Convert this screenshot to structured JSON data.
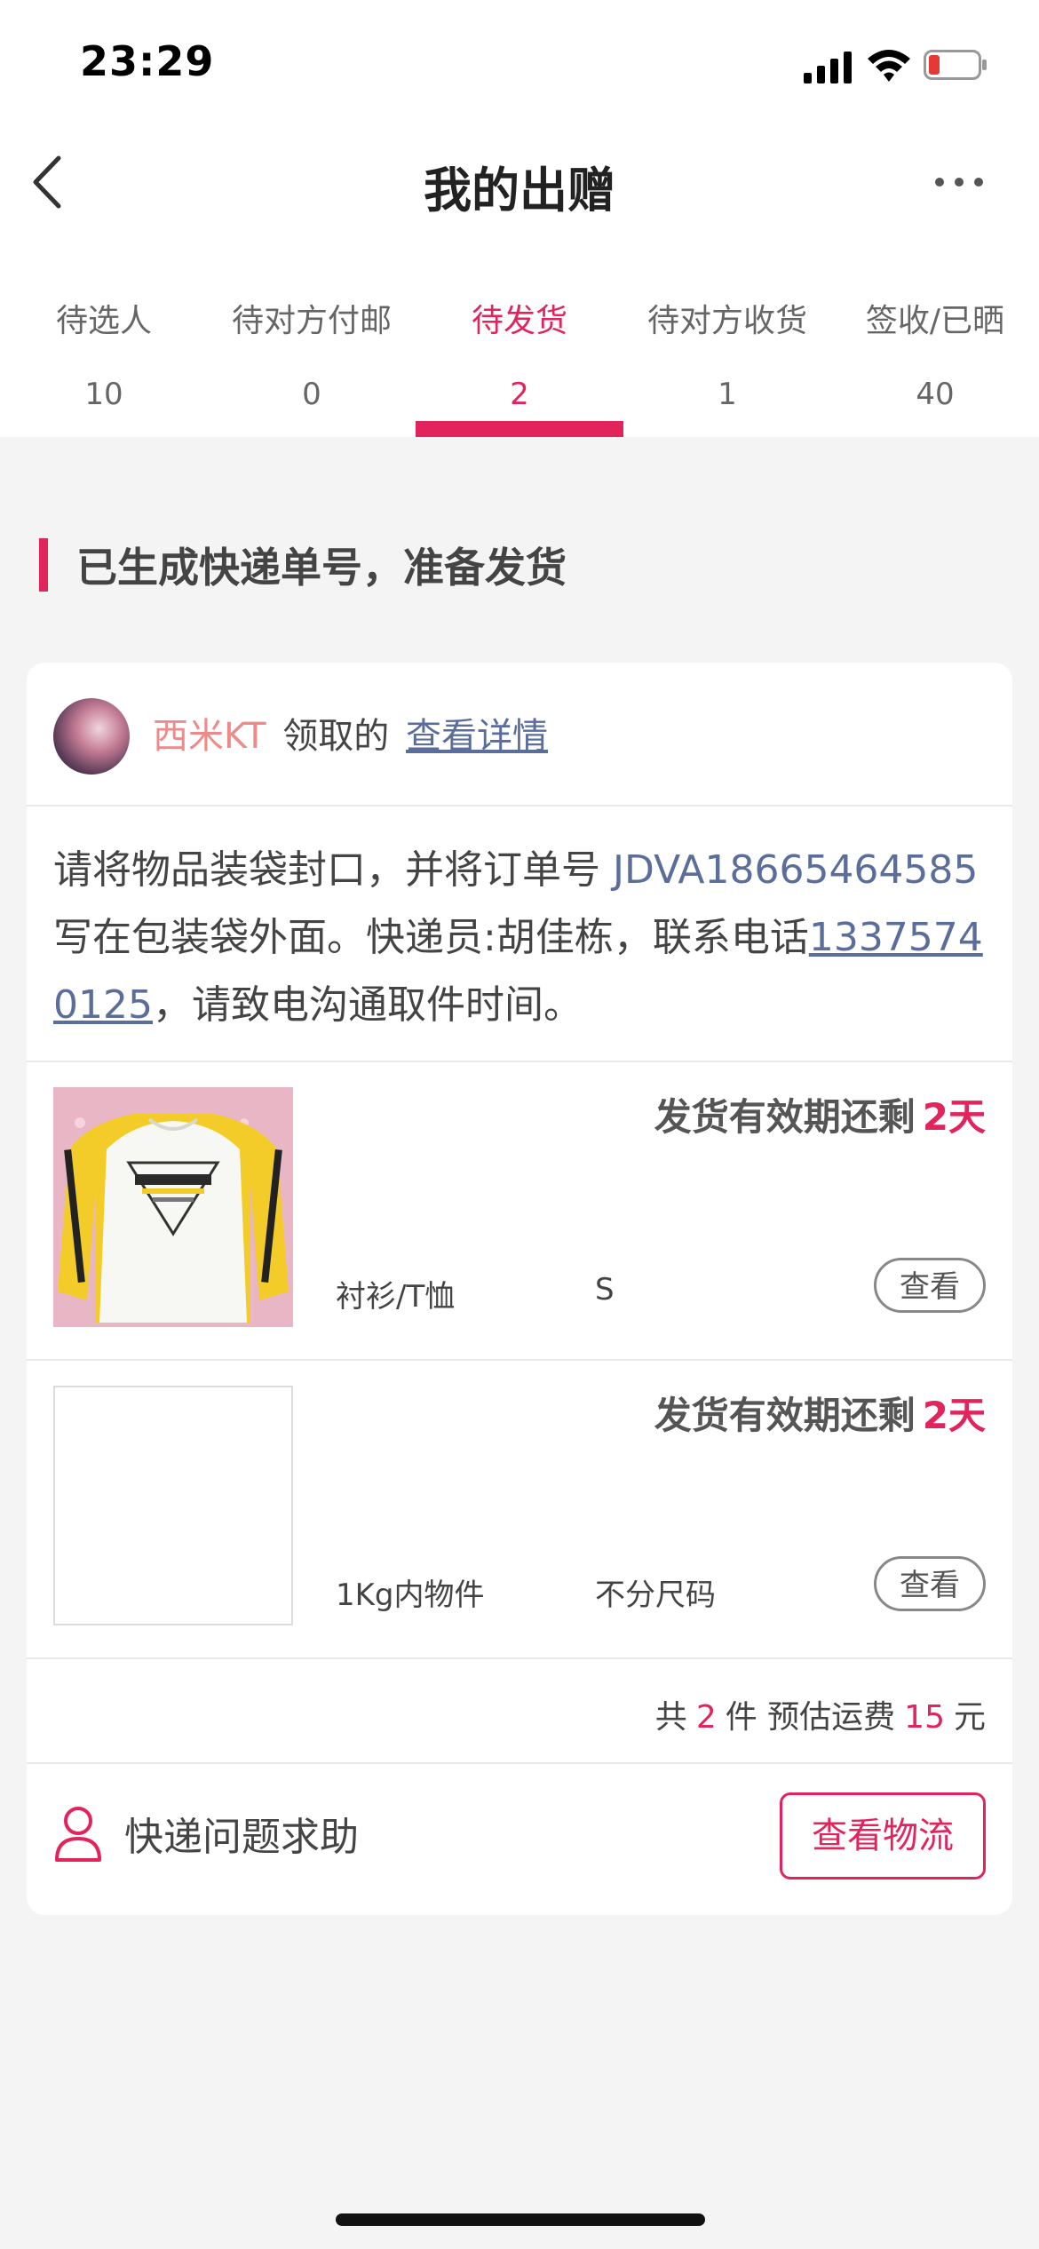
{
  "status_bar": {
    "time": "23:29"
  },
  "nav": {
    "title": "我的出赠"
  },
  "tabs": [
    {
      "label": "待选人",
      "count": "10"
    },
    {
      "label": "待对方付邮",
      "count": "0"
    },
    {
      "label": "待发货",
      "count": "2",
      "active": true
    },
    {
      "label": "待对方收货",
      "count": "1"
    },
    {
      "label": "签收/已晒",
      "count": "40"
    }
  ],
  "section_title": "已生成快递单号，准备发货",
  "receiver": {
    "username": "西米KT",
    "claimed_text": "领取的",
    "detail_link": "查看详情"
  },
  "instruction": {
    "part1": "请将物品装袋封口，并将订单号 ",
    "order_no": "JDVA18665464585",
    "part2": " 写在包装袋外面。快递员:胡佳栋，联系电话",
    "phone": "13375740125",
    "part3": "，请致电沟通取件时间。"
  },
  "items": [
    {
      "deadline_label": "发货有效期还剩",
      "days": "2天",
      "category": "衬衫/T恤",
      "size": "S",
      "view_label": "查看",
      "has_image": true
    },
    {
      "deadline_label": "发货有效期还剩",
      "days": "2天",
      "category": "1Kg内物件",
      "size": "不分尺码",
      "view_label": "查看",
      "has_image": false
    }
  ],
  "summary": {
    "prefix": "共",
    "count": "2",
    "count_unit": "件 预估运费",
    "fee": "15",
    "fee_unit": "元"
  },
  "footer": {
    "help_label": "快递问题求助",
    "logistics_button": "查看物流"
  },
  "colors": {
    "accent": "#e2245d",
    "link": "#5a6d9b",
    "username": "#ef8a8a"
  }
}
